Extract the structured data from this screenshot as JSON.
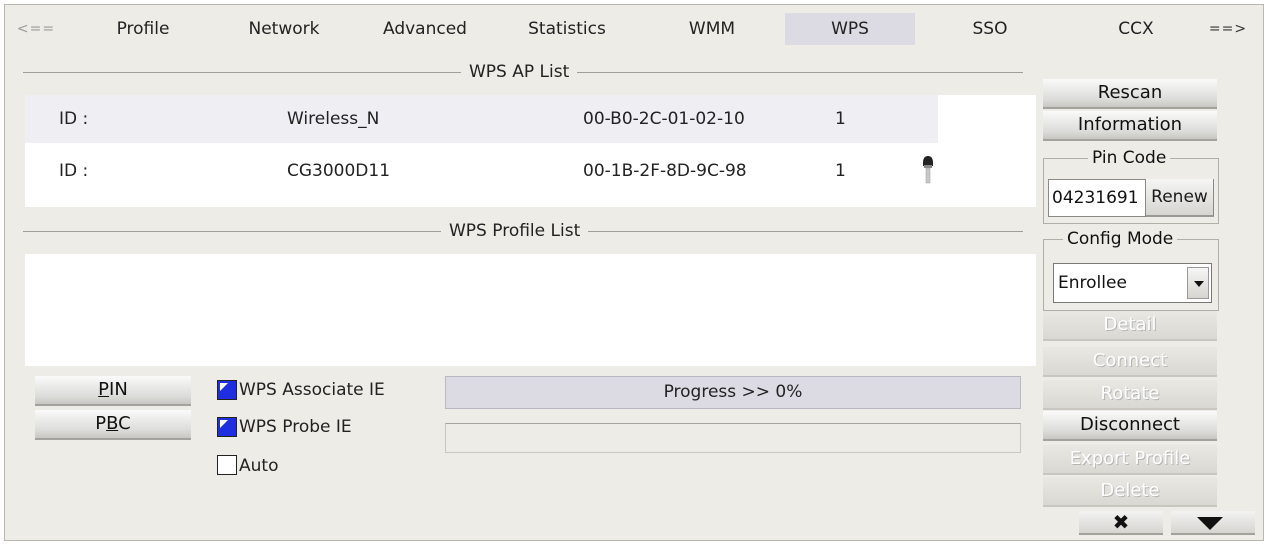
{
  "tabs": [
    {
      "label": "<==",
      "kind": "arrow"
    },
    {
      "label": "Profile"
    },
    {
      "label": "Network"
    },
    {
      "label": "Advanced"
    },
    {
      "label": "Statistics"
    },
    {
      "label": "WMM"
    },
    {
      "label": "WPS",
      "active": true
    },
    {
      "label": "SSO"
    },
    {
      "label": "CCX"
    },
    {
      "label": "==>",
      "kind": "arrow"
    }
  ],
  "ap_list": {
    "title": "WPS AP List",
    "rows": [
      {
        "id_label": "ID :",
        "ssid": "Wireless_N",
        "bssid": "00-B0-2C-01-02-10",
        "channel": "1",
        "selected": true,
        "secured": false
      },
      {
        "id_label": "ID :",
        "ssid": "CG3000D11",
        "bssid": "00-1B-2F-8D-9C-98",
        "channel": "1",
        "selected": false,
        "secured": true
      }
    ]
  },
  "profile_list": {
    "title": "WPS Profile List"
  },
  "actions": {
    "pin": {
      "prefix": "",
      "mnemonic": "P",
      "rest": "IN"
    },
    "pbc": {
      "prefix": "P",
      "mnemonic": "B",
      "rest": "C"
    }
  },
  "options": {
    "associate_ie": {
      "label": "WPS Associate IE",
      "checked": true
    },
    "probe_ie": {
      "label": "WPS Probe IE",
      "checked": true
    },
    "auto": {
      "label": "Auto",
      "checked": false
    }
  },
  "progress": {
    "text": "Progress >> 0%",
    "percent": 0
  },
  "side": {
    "rescan": "Rescan",
    "information": "Information",
    "pin_code": {
      "legend": "Pin Code",
      "value": "04231691",
      "renew": "Renew"
    },
    "config_mode": {
      "legend": "Config Mode",
      "selected": "Enrollee"
    },
    "detail": "Detail",
    "connect": "Connect",
    "rotate": "Rotate",
    "disconnect": "Disconnect",
    "export_profile": "Export Profile",
    "delete": "Delete"
  },
  "icons": {
    "close": "close-icon",
    "collapse": "triangle-down-icon",
    "key": "key-icon"
  },
  "colors": {
    "active_tab": "#dcdbe3",
    "checkbox_checked": "#1f2fe0",
    "progress_bar": "#dcdbe4"
  }
}
